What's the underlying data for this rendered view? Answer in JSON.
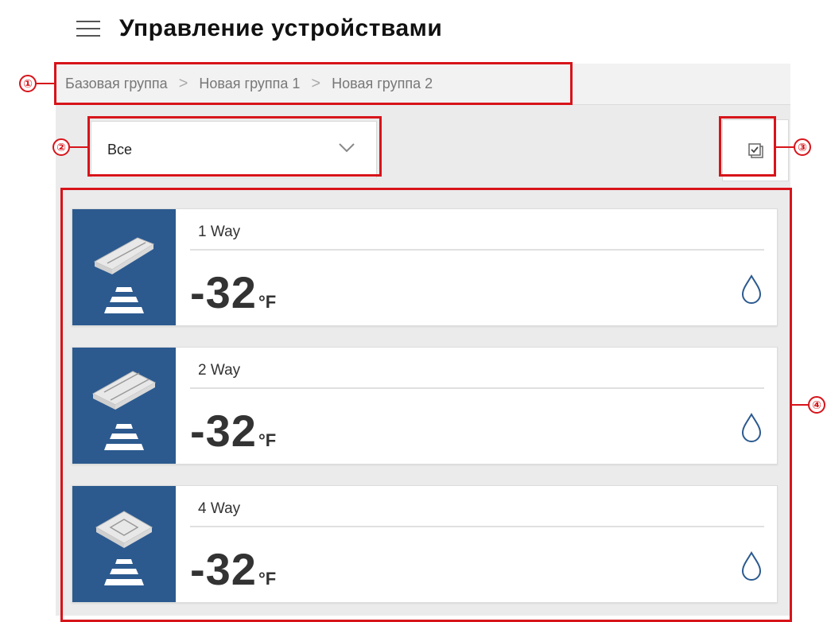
{
  "header": {
    "title": "Управление устройствами",
    "menu_icon": "hamburger-icon"
  },
  "breadcrumb": {
    "items": [
      "Базовая группа",
      "Новая группа 1",
      "Новая группа 2"
    ],
    "separator": ">"
  },
  "filter": {
    "selected": "Все",
    "icon": "chevron-down-icon"
  },
  "select_mode_button": {
    "icon": "multi-select-icon"
  },
  "devices": [
    {
      "name": "1 Way",
      "temperature": "-32",
      "unit": "°F",
      "icon": "water-drop-icon",
      "image": "1-way-cassette-icon"
    },
    {
      "name": "2 Way",
      "temperature": "-32",
      "unit": "°F",
      "icon": "water-drop-icon",
      "image": "2-way-cassette-icon"
    },
    {
      "name": "4 Way",
      "temperature": "-32",
      "unit": "°F",
      "icon": "water-drop-icon",
      "image": "4-way-cassette-icon"
    }
  ],
  "annotations": [
    "①",
    "②",
    "③",
    "④"
  ],
  "colors": {
    "accent": "#2c5a8f",
    "annotation": "#d7141a",
    "panel_bg": "#ebebeb"
  }
}
